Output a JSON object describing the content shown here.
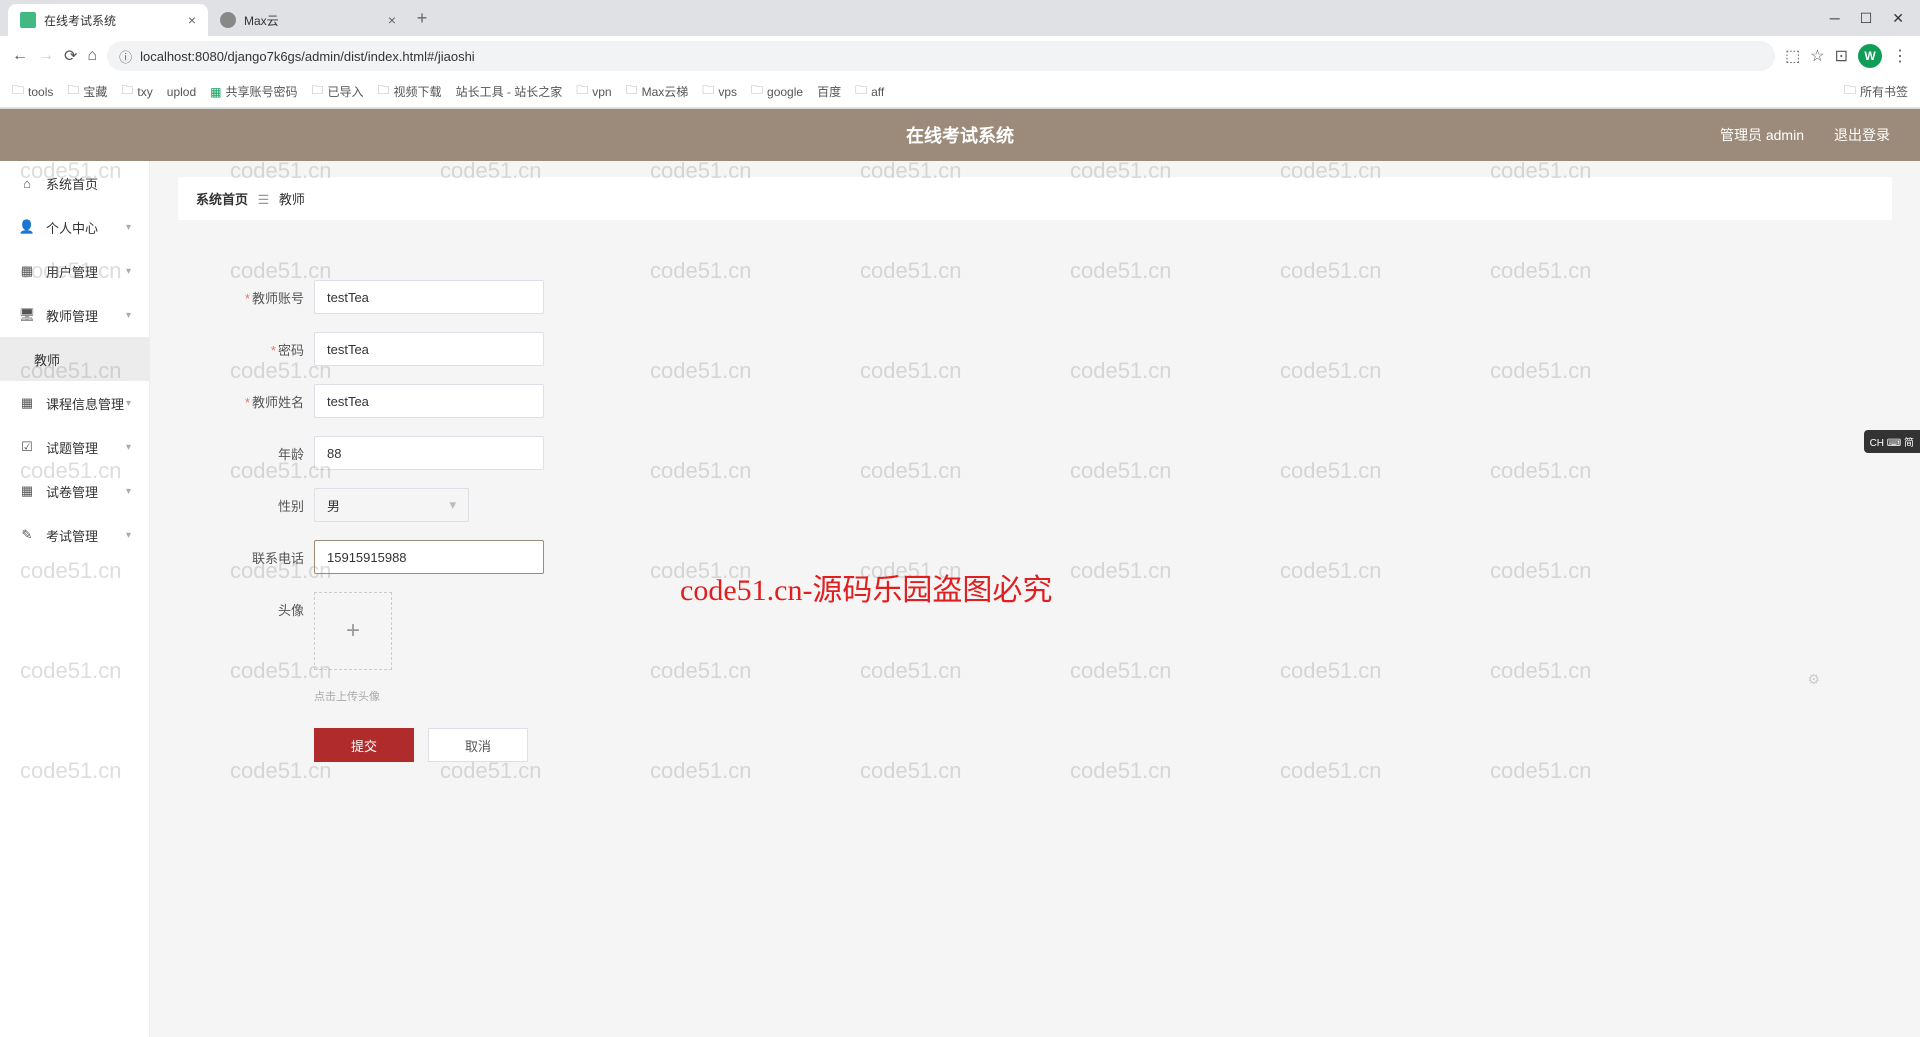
{
  "browser": {
    "tabs": [
      {
        "title": "在线考试系统"
      },
      {
        "title": "Max云"
      }
    ],
    "url": "localhost:8080/django7k6gs/admin/dist/index.html#/jiaoshi",
    "avatar_letter": "W",
    "bookmarks": [
      "tools",
      "宝藏",
      "txy",
      "uplod",
      "共享账号密码",
      "已导入",
      "视频下载",
      "站长工具 - 站长之家",
      "vpn",
      "Max云梯",
      "vps",
      "google",
      "百度",
      "aff"
    ],
    "all_bookmarks": "所有书签"
  },
  "header": {
    "title": "在线考试系统",
    "user_label": "管理员 admin",
    "logout": "退出登录"
  },
  "sidebar": {
    "items": [
      {
        "label": "系统首页",
        "icon": "home"
      },
      {
        "label": "个人中心",
        "icon": "user",
        "expand": true
      },
      {
        "label": "用户管理",
        "icon": "grid",
        "expand": true
      },
      {
        "label": "教师管理",
        "icon": "monitor",
        "expand": true
      },
      {
        "label": "教师",
        "sub": true
      },
      {
        "label": "课程信息管理",
        "icon": "grid",
        "expand": true
      },
      {
        "label": "试题管理",
        "icon": "check",
        "expand": true
      },
      {
        "label": "试卷管理",
        "icon": "grid2",
        "expand": true
      },
      {
        "label": "考试管理",
        "icon": "edit",
        "expand": true
      }
    ]
  },
  "breadcrumb": {
    "home": "系统首页",
    "current": "教师"
  },
  "form": {
    "fields": {
      "account": {
        "label": "教师账号",
        "value": "testTea",
        "required": true
      },
      "password": {
        "label": "密码",
        "value": "testTea",
        "required": true
      },
      "name": {
        "label": "教师姓名",
        "value": "testTea",
        "required": true
      },
      "age": {
        "label": "年龄",
        "value": "88",
        "required": false
      },
      "gender": {
        "label": "性别",
        "value": "男",
        "required": false
      },
      "phone": {
        "label": "联系电话",
        "value": "15915915988",
        "required": false
      },
      "avatar": {
        "label": "头像",
        "hint": "点击上传头像"
      }
    },
    "submit": "提交",
    "cancel": "取消"
  },
  "watermark": "code51.cn",
  "warning": "code51.cn-源码乐园盗图必究",
  "ime": "CH ⌨ 简"
}
